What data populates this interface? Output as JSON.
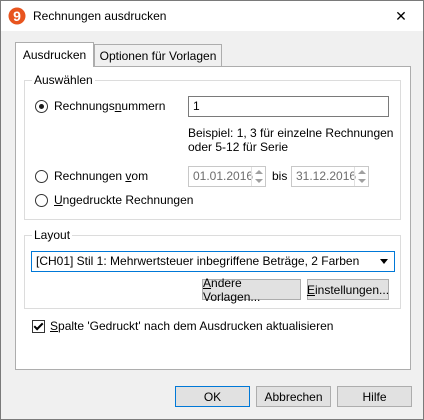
{
  "window": {
    "title": "Rechnungen ausdrucken",
    "app_icon_glyph": "9",
    "app_icon_color": "#e8541e",
    "close_glyph": "✕"
  },
  "tabs": [
    {
      "label": "Ausdrucken",
      "active": true
    },
    {
      "label": "Optionen für Vorlagen",
      "active": false
    }
  ],
  "select_group": {
    "label": "Auswählen",
    "option_numbers": {
      "label_before": "Rechnungs",
      "label_underlined": "n",
      "label_after": "ummern",
      "selected": true,
      "value": "1",
      "hint_line1": "Beispiel: 1, 3 für einzelne Rechnungen",
      "hint_line2": "oder 5-12 für Serie"
    },
    "option_dates": {
      "label_before": "Rechnungen ",
      "label_underlined": "v",
      "label_after": "om",
      "selected": false,
      "from": "01.01.2016",
      "to_label": "bis",
      "to": "31.12.2016"
    },
    "option_unprinted": {
      "label_before": "",
      "label_underlined": "U",
      "label_after": "ngedruckte Rechnungen",
      "selected": false
    }
  },
  "layout_group": {
    "label": "Layout",
    "template_value": "[CH01] Stil 1: Mehrwertsteuer inbegriffene Beträge, 2 Farben",
    "other_templates_before": "",
    "other_templates_underlined": "A",
    "other_templates_after": "ndere Vorlagen...",
    "settings_before": "",
    "settings_underlined": "E",
    "settings_after": "instellungen..."
  },
  "update_checkbox": {
    "checked": true,
    "label_before": "",
    "label_underlined": "S",
    "label_after": "palte 'Gedruckt' nach dem Ausdrucken aktualisieren"
  },
  "buttons": {
    "ok": "OK",
    "cancel": "Abbrechen",
    "help": "Hilfe"
  }
}
